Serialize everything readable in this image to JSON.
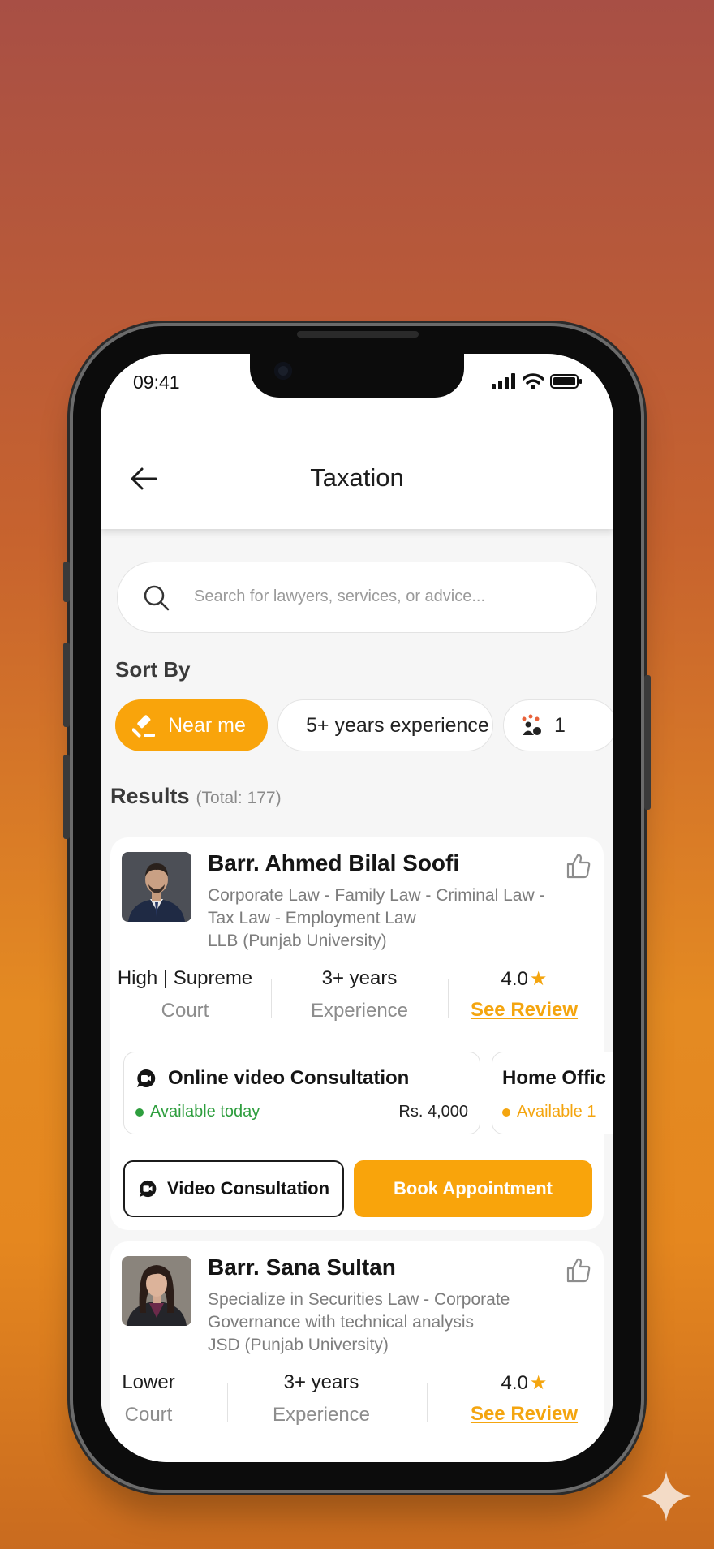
{
  "status_bar": {
    "time": "09:41"
  },
  "header": {
    "title": "Taxation"
  },
  "search": {
    "placeholder": "Search for lawyers, services, or advice..."
  },
  "sort": {
    "label": "Sort By",
    "chips": [
      {
        "label": "Near me",
        "active": true,
        "icon": "gavel-icon"
      },
      {
        "label": "5+ years experience",
        "active": false,
        "icon": "users-badge-icon"
      },
      {
        "label": "1",
        "active": false,
        "icon": "users-rating-icon"
      }
    ]
  },
  "results": {
    "label": "Results",
    "total": "(Total: 177)"
  },
  "lawyers": [
    {
      "name": "Barr. Ahmed Bilal Soofi",
      "specialties_line1": "Corporate Law - Family Law - Criminal Law -",
      "specialties_line2": "Tax Law - Employment Law",
      "education": "LLB (Punjab University)",
      "court_value": "High | Supreme",
      "court_label": "Court",
      "experience_value": "3+ years",
      "experience_label": "Experience",
      "rating": "4.0",
      "review_link": "See Review",
      "consultations": [
        {
          "title": "Online video Consultation",
          "availability": "Available today",
          "availability_color": "#2e9e3e",
          "price": "Rs. 4,000"
        },
        {
          "title": "Home Offic",
          "availability": "Available 1",
          "availability_color": "#f4a50f",
          "price": ""
        }
      ],
      "video_button": "Video Consultation",
      "book_button": "Book Appointment"
    },
    {
      "name": "Barr. Sana Sultan",
      "specialties_line1": "Specialize in Securities Law - Corporate",
      "specialties_line2": "Governance with technical analysis",
      "education": "JSD (Punjab University)",
      "court_value": "Lower",
      "court_label": "Court",
      "experience_value": "3+ years",
      "experience_label": "Experience",
      "rating": "4.0",
      "review_link": "See Review"
    }
  ],
  "colors": {
    "accent": "#f9a40b",
    "available_green": "#2e9e3e",
    "star": "#f4a50f"
  }
}
